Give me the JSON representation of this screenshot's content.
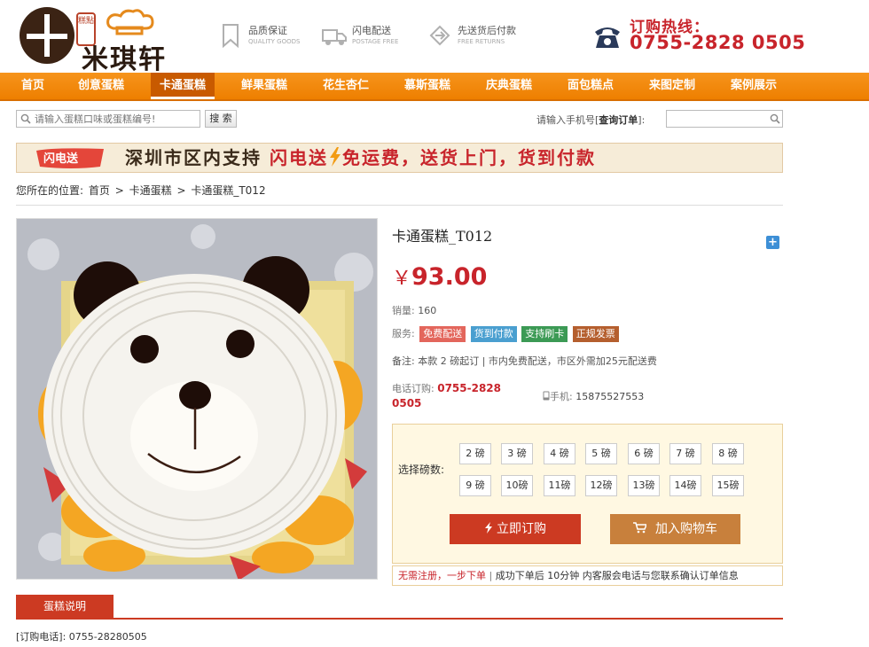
{
  "logo": {
    "seal": "糕點",
    "name": "米琪轩"
  },
  "badges": [
    {
      "label": "品质保证",
      "sub": "QUALITY GOODS",
      "icon": "bookmark-icon"
    },
    {
      "label": "闪电配送",
      "sub": "POSTAGE FREE",
      "icon": "truck-icon"
    },
    {
      "label": "先送货后付款",
      "sub": "FREE RETURNS",
      "icon": "return-icon"
    }
  ],
  "hotline": {
    "label": "订购热线：",
    "number": "0755-2828 0505",
    "icon": "telephone-icon"
  },
  "nav": [
    "首页",
    "创意蛋糕",
    "卡通蛋糕",
    "鲜果蛋糕",
    "花生杏仁",
    "慕斯蛋糕",
    "庆典蛋糕",
    "面包糕点",
    "来图定制",
    "案例展示"
  ],
  "nav_active": "卡通蛋糕",
  "search": {
    "placeholder": "请输入蛋糕口味或蛋糕编号!",
    "button": "搜 索"
  },
  "phone_query": {
    "label_pre": "请输入手机号[",
    "label_bold": "查询订单",
    "label_post": "]:"
  },
  "banner": {
    "badge": "闪电送",
    "text1": "深圳市区内支持 ",
    "text2": "闪电送",
    "text3": "免运费，送货上门，货到付款"
  },
  "breadcrumb": {
    "prefix": "您所在的位置:",
    "items": [
      "首页",
      "卡通蛋糕",
      "卡通蛋糕_T012"
    ],
    "sep": ">"
  },
  "product": {
    "title": "卡通蛋糕_T012",
    "currency": "￥",
    "price": "93.00",
    "sales_label": "销量:",
    "sales": "160",
    "service_label": "服务:",
    "services": [
      {
        "label": "免费配送",
        "color": "#e3665c"
      },
      {
        "label": "货到付款",
        "color": "#4a9fd0"
      },
      {
        "label": "支持刷卡",
        "color": "#3c9a55"
      },
      {
        "label": "正规发票",
        "color": "#b55f2e"
      }
    ],
    "note": "备注: 本款 2 磅起订 | 市内免费配送，市区外需加25元配送费",
    "tel_label": "电话订购:",
    "tel": "0755-2828 0505",
    "mobile_label": "手机:",
    "mobile": "15875527553"
  },
  "weights": {
    "label": "选择磅数:",
    "options": [
      "2 磅",
      "3 磅",
      "4 磅",
      "5 磅",
      "6 磅",
      "7 磅",
      "8 磅",
      "9 磅",
      "10磅",
      "11磅",
      "12磅",
      "13磅",
      "14磅",
      "15磅"
    ]
  },
  "actions": {
    "order": "立即订购",
    "cart": "加入购物车"
  },
  "tip": {
    "red": "无需注册，一步下单",
    "rest": "成功下单后 10分钟 内客服会电话与您联系确认订单信息"
  },
  "tabs": [
    "蛋糕说明"
  ],
  "order_tel": "[订购电话]: 0755-28280505",
  "colors": {
    "nav": "#f08300",
    "accent": "#c8242b",
    "button_order": "#cc3a22",
    "button_cart": "#c8803c"
  }
}
